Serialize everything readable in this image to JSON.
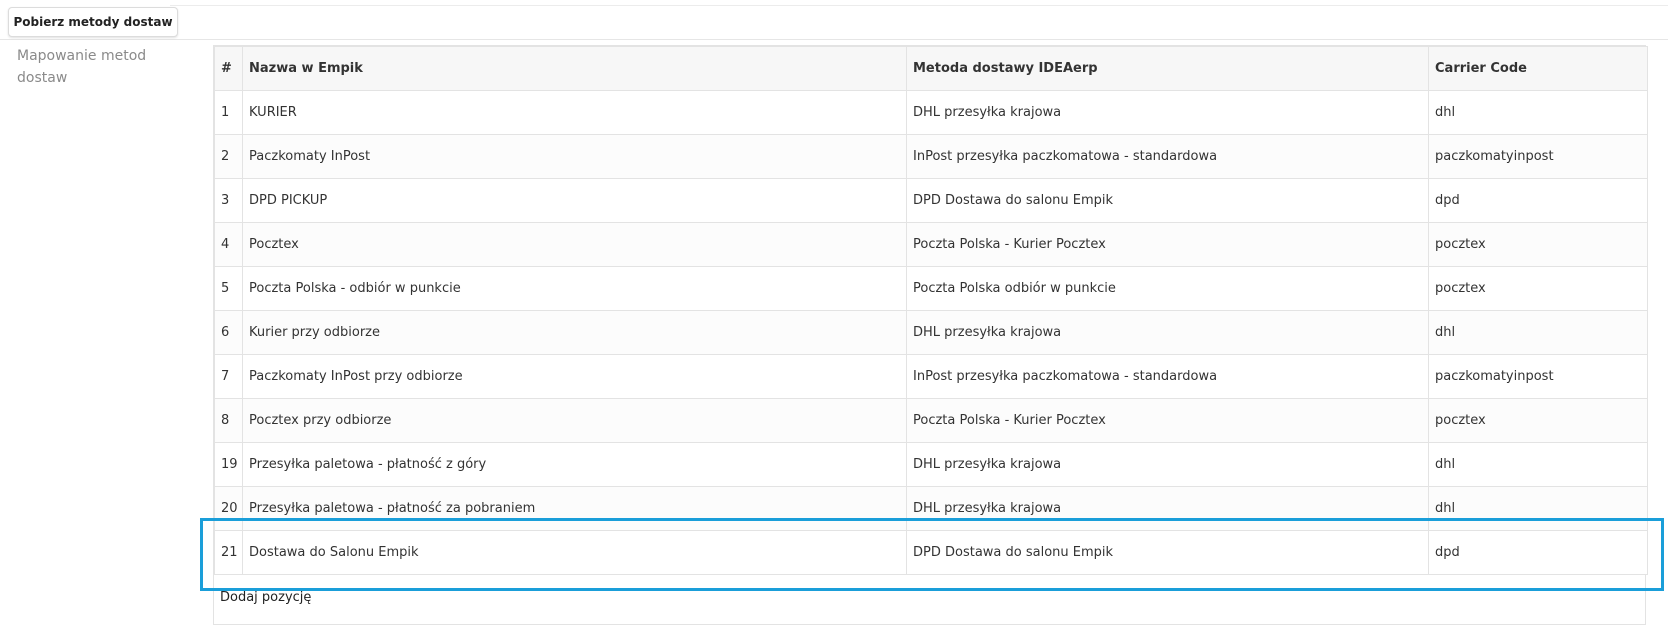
{
  "toolbar": {
    "fetch_button_label": "Pobierz metody dostaw"
  },
  "section": {
    "label": "Mapowanie metod dostaw"
  },
  "table": {
    "headers": {
      "num": "#",
      "name": "Nazwa w Empik",
      "method": "Metoda dostawy IDEAerp",
      "code": "Carrier Code"
    },
    "rows": [
      {
        "num": "1",
        "name": "KURIER",
        "method": "DHL przesyłka krajowa",
        "code": "dhl"
      },
      {
        "num": "2",
        "name": "Paczkomaty InPost",
        "method": "InPost przesyłka paczkomatowa - standardowa",
        "code": "paczkomatyinpost"
      },
      {
        "num": "3",
        "name": "DPD PICKUP",
        "method": "DPD Dostawa do salonu Empik",
        "code": "dpd"
      },
      {
        "num": "4",
        "name": "Pocztex",
        "method": "Poczta Polska - Kurier Pocztex",
        "code": "pocztex"
      },
      {
        "num": "5",
        "name": "Poczta Polska - odbiór w punkcie",
        "method": "Poczta Polska odbiór w punkcie",
        "code": "pocztex"
      },
      {
        "num": "6",
        "name": "Kurier przy odbiorze",
        "method": "DHL przesyłka krajowa",
        "code": "dhl"
      },
      {
        "num": "7",
        "name": "Paczkomaty InPost przy odbiorze",
        "method": "InPost przesyłka paczkomatowa - standardowa",
        "code": "paczkomatyinpost"
      },
      {
        "num": "8",
        "name": "Pocztex przy odbiorze",
        "method": "Poczta Polska - Kurier Pocztex",
        "code": "pocztex"
      },
      {
        "num": "19",
        "name": "Przesyłka paletowa - płatność z góry",
        "method": "DHL przesyłka krajowa",
        "code": "dhl"
      },
      {
        "num": "20",
        "name": "Przesyłka paletowa - płatność za pobraniem",
        "method": "DHL przesyłka krajowa",
        "code": "dhl"
      },
      {
        "num": "21",
        "name": "Dostawa do Salonu Empik",
        "method": "DPD Dostawa do salonu Empik",
        "code": "dpd"
      }
    ],
    "add_row_label": "Dodaj pozycję"
  },
  "colors": {
    "highlight": "#1a9ed9",
    "border": "#e3e3e3",
    "header_bg": "#f7f7f7"
  }
}
